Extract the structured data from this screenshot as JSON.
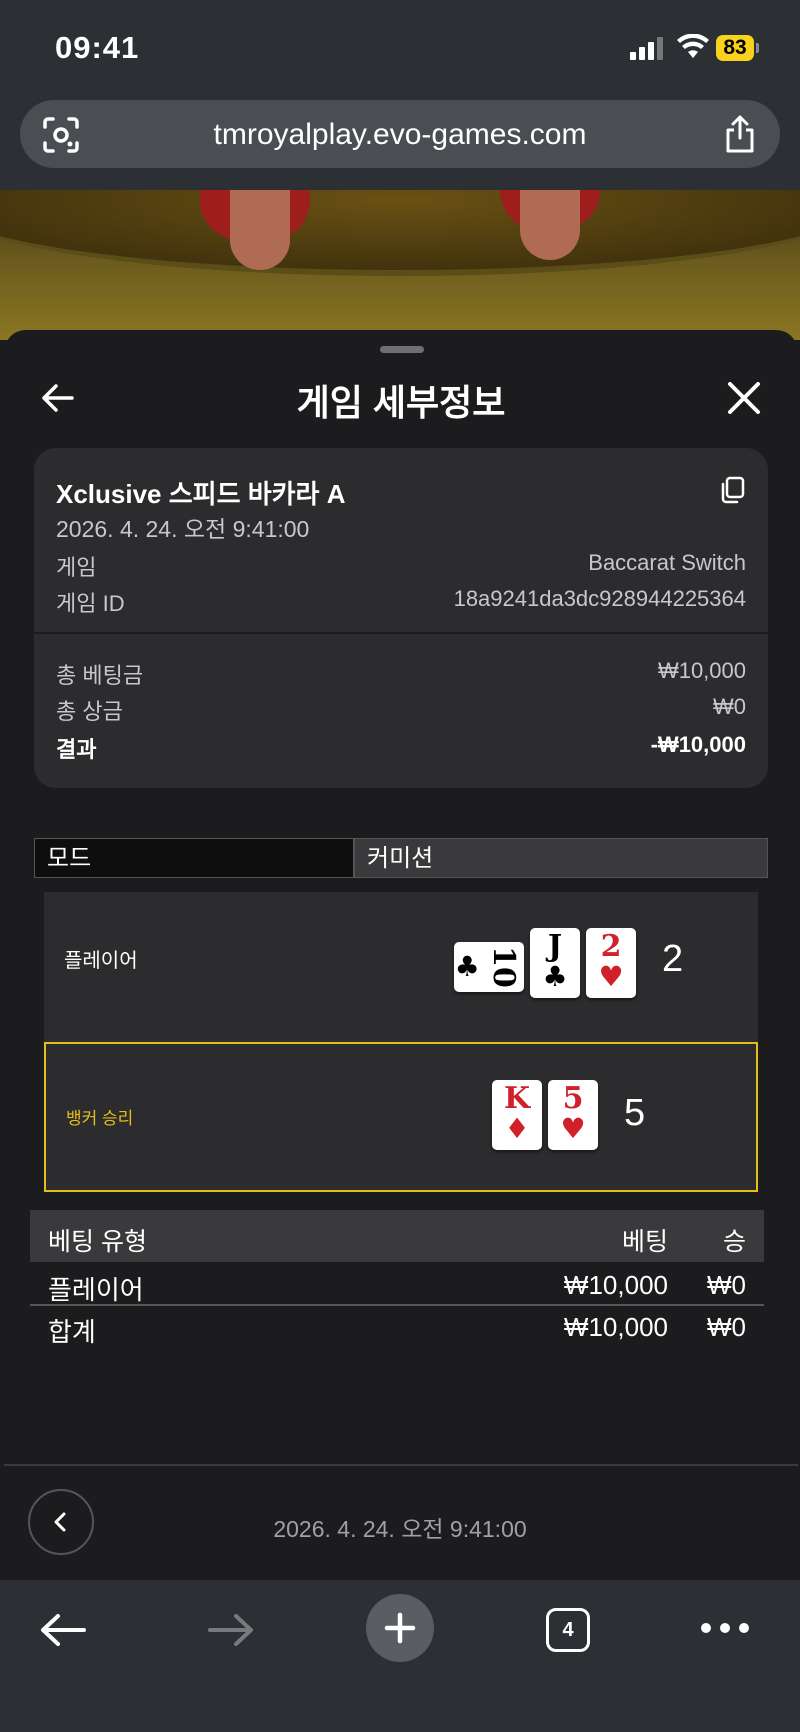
{
  "status": {
    "time": "09:41",
    "battery": "83"
  },
  "browser": {
    "url": "tmroyalplay.evo-games.com",
    "tab_count": "4"
  },
  "sheet": {
    "title": "게임 세부정보",
    "card": {
      "table_name": "Xclusive 스피드 바카라 A",
      "datetime": "2026. 4. 24. 오전 9:41:00",
      "game_label": "게임",
      "game_value": "Baccarat Switch",
      "game_id_label": "게임 ID",
      "game_id_value": "18a9241da3dc928944225364",
      "total_bet_label": "총 베팅금",
      "total_bet_value": "₩10,000",
      "total_win_label": "총 상금",
      "total_win_value": "₩0",
      "result_label": "결과",
      "result_value": "-₩10,000"
    },
    "mode": {
      "label": "모드",
      "value": "커미션"
    },
    "hands": {
      "player": {
        "label": "플레이어",
        "total": "2",
        "cards": [
          {
            "rank": "10",
            "suit": "♣",
            "color": "#000000"
          },
          {
            "rank": "J",
            "suit": "♣",
            "color": "#000000"
          },
          {
            "rank": "2",
            "suit": "♥",
            "color": "#d0202a"
          }
        ]
      },
      "banker": {
        "label": "뱅커 승리",
        "total": "5",
        "cards": [
          {
            "rank": "K",
            "suit": "♦",
            "color": "#d0202a"
          },
          {
            "rank": "5",
            "suit": "♥",
            "color": "#d0202a"
          }
        ]
      }
    },
    "bets": {
      "headers": {
        "type": "베팅 유형",
        "bet": "베팅",
        "win": "승"
      },
      "rows": [
        {
          "type": "플레이어",
          "bet": "₩10,000",
          "win": "₩0"
        },
        {
          "type": "합계",
          "bet": "₩10,000",
          "win": "₩0"
        }
      ]
    },
    "footer_date": "2026. 4. 24. 오전 9:41:00"
  },
  "colors": {
    "accent": "#e5bd1a",
    "sheet_bg": "#1c1c1e",
    "card_bg": "#2c2c2e"
  }
}
